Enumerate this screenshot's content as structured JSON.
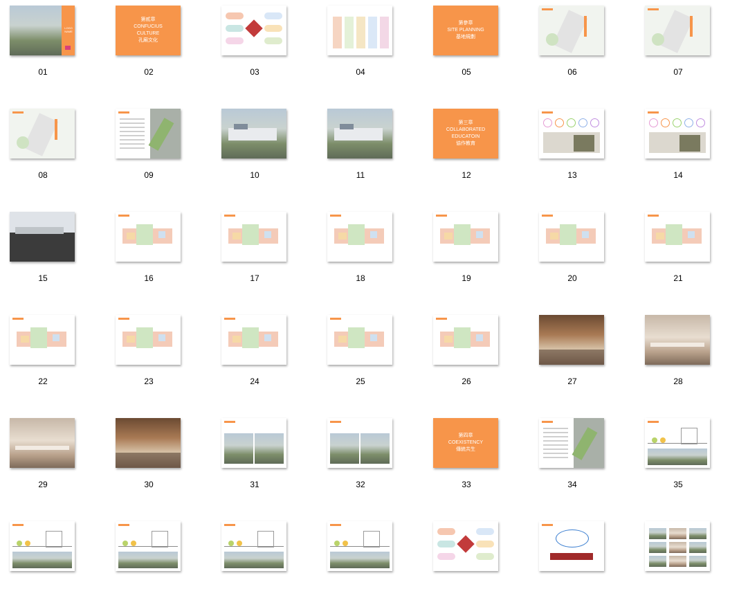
{
  "thumbnails": [
    {
      "label": "01",
      "kind": "photo-cover",
      "text": [
        "LOGO NAME"
      ]
    },
    {
      "label": "02",
      "kind": "section",
      "text": [
        "第貳章",
        "CONFUCIUS",
        "CULTURE",
        "孔廟文化"
      ]
    },
    {
      "label": "03",
      "kind": "diagram-hex"
    },
    {
      "label": "04",
      "kind": "columns"
    },
    {
      "label": "05",
      "kind": "section",
      "text": [
        "第參章",
        "SITE PLANNING",
        "基地規劃"
      ]
    },
    {
      "label": "06",
      "kind": "map"
    },
    {
      "label": "07",
      "kind": "map"
    },
    {
      "label": "08",
      "kind": "map"
    },
    {
      "label": "09",
      "kind": "table-map"
    },
    {
      "label": "10",
      "kind": "photo"
    },
    {
      "label": "11",
      "kind": "photo"
    },
    {
      "label": "12",
      "kind": "section",
      "text": [
        "第三章",
        "COLLABORATED",
        "EDUCATOIN",
        "協作教育"
      ]
    },
    {
      "label": "13",
      "kind": "circles"
    },
    {
      "label": "14",
      "kind": "circles"
    },
    {
      "label": "15",
      "kind": "section-dark"
    },
    {
      "label": "16",
      "kind": "plans"
    },
    {
      "label": "17",
      "kind": "plans"
    },
    {
      "label": "18",
      "kind": "plans"
    },
    {
      "label": "19",
      "kind": "plans"
    },
    {
      "label": "20",
      "kind": "plans"
    },
    {
      "label": "21",
      "kind": "plans"
    },
    {
      "label": "22",
      "kind": "plans"
    },
    {
      "label": "23",
      "kind": "plans"
    },
    {
      "label": "24",
      "kind": "plans"
    },
    {
      "label": "25",
      "kind": "plans"
    },
    {
      "label": "26",
      "kind": "plans"
    },
    {
      "label": "27",
      "kind": "interior-warm"
    },
    {
      "label": "28",
      "kind": "interior-light"
    },
    {
      "label": "29",
      "kind": "interior-light"
    },
    {
      "label": "30",
      "kind": "interior-warm"
    },
    {
      "label": "31",
      "kind": "photo-pair"
    },
    {
      "label": "32",
      "kind": "photo-pair"
    },
    {
      "label": "33",
      "kind": "section",
      "text": [
        "第四章",
        "COEXISTENCY",
        "傳統共生"
      ]
    },
    {
      "label": "34",
      "kind": "table-map"
    },
    {
      "label": "35",
      "kind": "elevation"
    },
    {
      "label": "",
      "kind": "elevation"
    },
    {
      "label": "",
      "kind": "elevation"
    },
    {
      "label": "",
      "kind": "elevation"
    },
    {
      "label": "",
      "kind": "elevation"
    },
    {
      "label": "",
      "kind": "diagram-hex"
    },
    {
      "label": "",
      "kind": "network"
    },
    {
      "label": "",
      "kind": "photo-grid"
    }
  ],
  "colors": {
    "accent": "#f7954a",
    "section_bg": "#f7954a"
  }
}
